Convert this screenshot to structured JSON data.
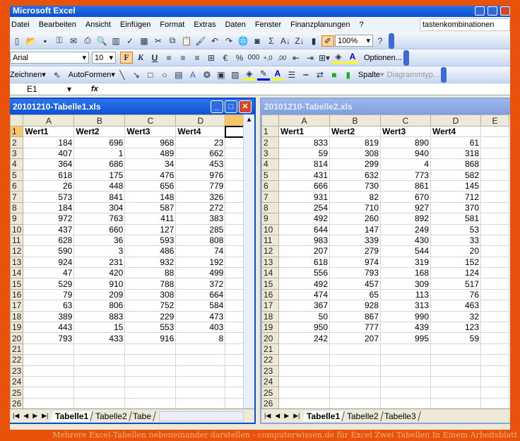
{
  "app": {
    "title": "Microsoft Excel"
  },
  "menu": [
    "Datei",
    "Bearbeiten",
    "Ansicht",
    "Einfügen",
    "Format",
    "Extras",
    "Daten",
    "Fenster",
    "Finanzplanungen",
    "?"
  ],
  "help_box": "tastenkombinationen",
  "toolbar_standard": {
    "icons": [
      "new-icon",
      "open-icon",
      "save-icon",
      "permission-icon",
      "email-icon",
      "print-icon",
      "print-preview-icon",
      "research-icon",
      "spelling-icon",
      "clipboard-icon",
      "cut-icon",
      "copy-icon",
      "paste-icon",
      "format-painter-icon",
      "undo-icon",
      "redo-icon",
      "hyperlink-icon",
      "camera-icon",
      "autosum-icon",
      "sort-asc-icon",
      "sort-desc-icon",
      "chart-wizard-icon",
      "drawing-icon",
      "help-icon"
    ],
    "zoom": "100%"
  },
  "toolbar_format": {
    "font": "Arial",
    "size": "10",
    "bold": "F",
    "italic": "K",
    "underline": "U",
    "percent": "%",
    "thousands": "000",
    "options": "Optionen..."
  },
  "toolbar_drawing": {
    "draw": "Zeichnen",
    "autoshapes": "AutoFormen",
    "column": "Spalte",
    "chart_type": "Diagrammtyp..."
  },
  "formula_bar": {
    "cell": "E1",
    "fx": "fx",
    "value": ""
  },
  "columns_left": [
    "A",
    "B",
    "C",
    "D",
    ""
  ],
  "columns_right": [
    "A",
    "B",
    "C",
    "D",
    "E"
  ],
  "left": {
    "title": "20101210-Tabelle1.xls",
    "headers": [
      "Wert1",
      "Wert2",
      "Wert3",
      "Wert4"
    ],
    "rows": [
      [
        184,
        696,
        968,
        23
      ],
      [
        407,
        1,
        489,
        662
      ],
      [
        364,
        686,
        34,
        453
      ],
      [
        618,
        175,
        476,
        976
      ],
      [
        26,
        448,
        656,
        779
      ],
      [
        573,
        841,
        148,
        326
      ],
      [
        184,
        304,
        587,
        272
      ],
      [
        972,
        763,
        411,
        383
      ],
      [
        437,
        660,
        127,
        285
      ],
      [
        628,
        36,
        593,
        808
      ],
      [
        590,
        3,
        486,
        74
      ],
      [
        924,
        231,
        932,
        192
      ],
      [
        47,
        420,
        88,
        499
      ],
      [
        529,
        910,
        788,
        372
      ],
      [
        79,
        209,
        308,
        664
      ],
      [
        63,
        806,
        752,
        584
      ],
      [
        389,
        883,
        229,
        473
      ],
      [
        443,
        15,
        553,
        403
      ],
      [
        793,
        433,
        916,
        8
      ]
    ],
    "tabs": [
      "Tabelle1",
      "Tabelle2",
      "Tabe"
    ]
  },
  "right": {
    "title": "20101210-Tabelle2.xls",
    "headers": [
      "Wert1",
      "Wert2",
      "Wert3",
      "Wert4"
    ],
    "rows": [
      [
        833,
        819,
        890,
        61
      ],
      [
        59,
        308,
        940,
        318
      ],
      [
        814,
        299,
        4,
        868
      ],
      [
        431,
        632,
        773,
        582
      ],
      [
        666,
        730,
        861,
        145
      ],
      [
        931,
        82,
        670,
        712
      ],
      [
        254,
        710,
        927,
        370
      ],
      [
        492,
        260,
        892,
        581
      ],
      [
        644,
        147,
        249,
        53
      ],
      [
        983,
        339,
        430,
        33
      ],
      [
        207,
        279,
        544,
        20
      ],
      [
        618,
        974,
        319,
        152
      ],
      [
        556,
        793,
        168,
        124
      ],
      [
        492,
        457,
        309,
        517
      ],
      [
        474,
        65,
        113,
        76
      ],
      [
        367,
        928,
        313,
        463
      ],
      [
        50,
        867,
        990,
        32
      ],
      [
        950,
        777,
        439,
        123
      ],
      [
        242,
        207,
        995,
        59
      ]
    ],
    "tabs": [
      "Tabelle1",
      "Tabelle2",
      "Tabelle3"
    ]
  },
  "caption": "Mehrere Excel-Tabellen nebeneinander darstellen - computerwissen.de für Excel Zwei Tabellen In Einem Arbeitsblatt"
}
